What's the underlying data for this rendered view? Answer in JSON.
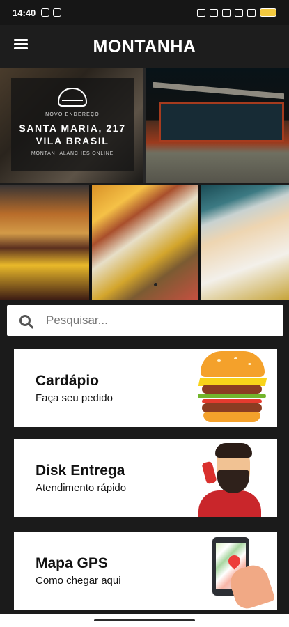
{
  "status_bar": {
    "time": "14:40",
    "battery_color": "#f3c93f"
  },
  "app_bar": {
    "title": "MONTANHA",
    "menu_icon": "hamburger-menu-icon"
  },
  "hero": {
    "banner_icon": "burger-icon",
    "label": "NOVO ENDEREÇO",
    "address_line_1": "SANTA MARIA, 217",
    "address_line_2": "VILA BRASIL",
    "website": "MONTANHALANCHES.ONLINE"
  },
  "gallery": {
    "items": [
      "burger-photo",
      "fries-and-sauces-photo",
      "customer-with-food-photo"
    ]
  },
  "search": {
    "placeholder": "Pesquisar...",
    "icon": "search-icon"
  },
  "cards": [
    {
      "title": "Cardápio",
      "subtitle": "Faça seu pedido",
      "illustration": "burger-illustration"
    },
    {
      "title": "Disk Entrega",
      "subtitle": "Atendimento rápido",
      "illustration": "delivery-person-phone-illustration"
    },
    {
      "title": "Mapa GPS",
      "subtitle": "Como chegar aqui",
      "illustration": "gps-phone-map-illustration"
    }
  ]
}
